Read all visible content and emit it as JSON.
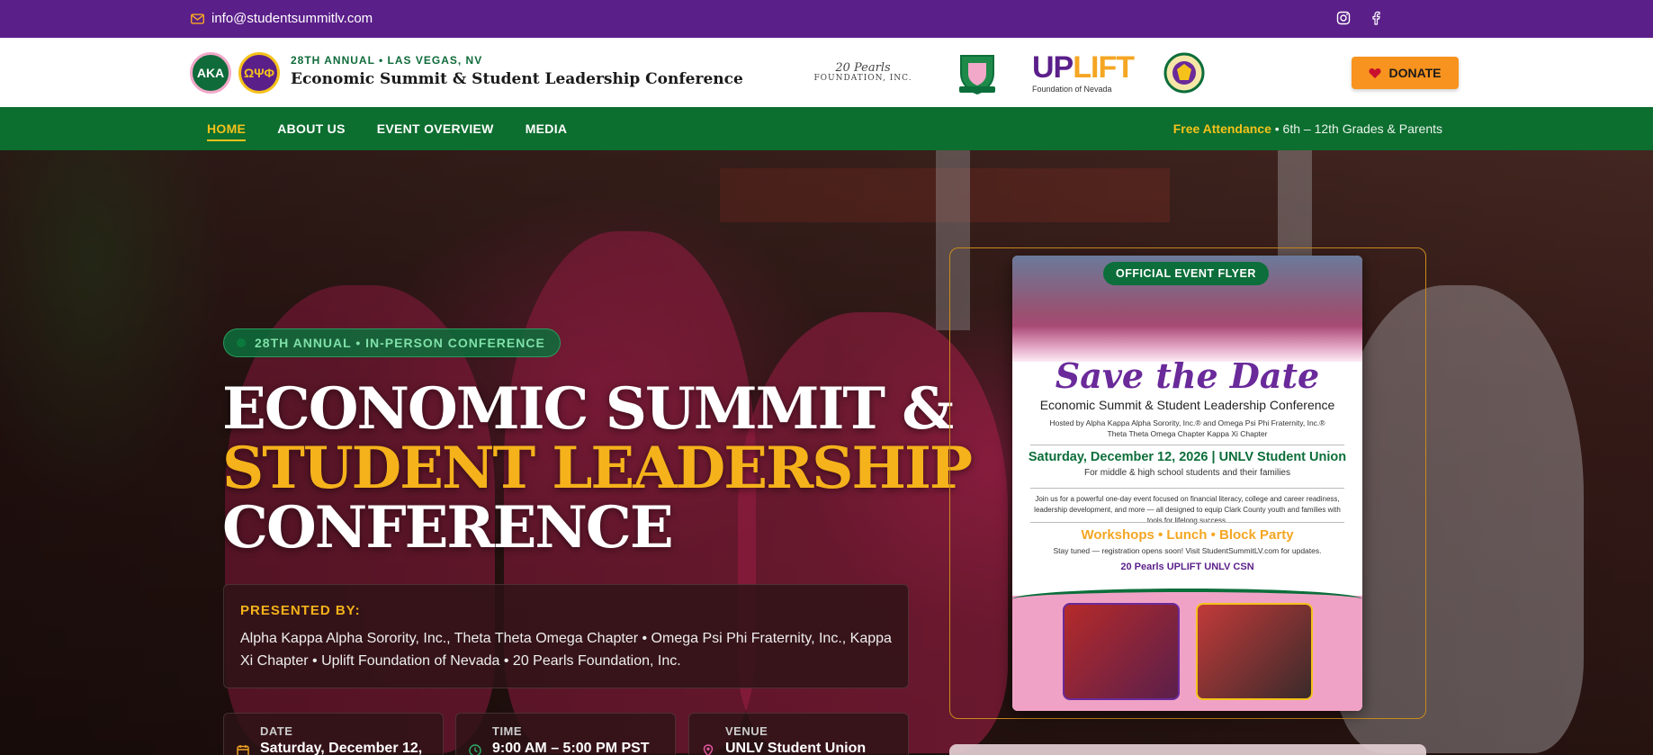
{
  "topbar": {
    "email": "info@studentsummitlv.com",
    "email_icon": "mail-icon",
    "social": [
      "instagram-icon",
      "facebook-icon"
    ]
  },
  "header": {
    "badge_aka": "AKA",
    "badge_opp": "ΩΨΦ",
    "eyebrow": "28TH ANNUAL • LAS VEGAS, NV",
    "title": "Economic Summit & Student Leadership Conference",
    "partners": {
      "pearls_main": "20 Pearls",
      "pearls_sub": "FOUNDATION, INC.",
      "uplift_up": "UP",
      "uplift_lift": "LIFT",
      "uplift_sub": "Foundation of Nevada"
    },
    "donate_label": "DONATE"
  },
  "nav": {
    "items": [
      "HOME",
      "ABOUT US",
      "EVENT OVERVIEW",
      "MEDIA"
    ],
    "note_bold": "Free Attendance",
    "note_rest": " • 6th – 12th Grades & Parents"
  },
  "hero": {
    "pill": "28TH ANNUAL • IN-PERSON CONFERENCE",
    "title_line1": "ECONOMIC SUMMIT &",
    "title_line2": "STUDENT LEADERSHIP",
    "title_line3": "CONFERENCE",
    "presented_label": "PRESENTED BY:",
    "presented_text": "Alpha Kappa Alpha Sorority, Inc., Theta Theta Omega Chapter • Omega Psi Phi Fraternity, Inc., Kappa Xi Chapter • Uplift Foundation of Nevada • 20 Pearls Foundation, Inc.",
    "cards": [
      {
        "label": "DATE",
        "value": "Saturday, December 12,"
      },
      {
        "label": "TIME",
        "value": "9:00 AM – 5:00 PM PST"
      },
      {
        "label": "VENUE",
        "value": "UNLV Student Union"
      }
    ]
  },
  "flyer": {
    "tag": "OFFICIAL EVENT FLYER",
    "save": "Save the Date",
    "subtitle": "Economic Summit & Student Leadership Conference",
    "host1": "Hosted by Alpha Kappa Alpha Sorority, Inc.® and Omega Psi Phi Fraternity, Inc.®",
    "host2": "Theta Theta Omega Chapter                        Kappa Xi Chapter",
    "date": "Saturday, December 12, 2026 | UNLV Student Union",
    "for": "For middle & high school students and their families",
    "body": "Join us for a powerful one-day event focused on financial literacy, college and career readiness, leadership development, and more — all designed to equip Clark County youth and families with tools for lifelong success.",
    "workshops": "Workshops • Lunch • Block Party",
    "stay": "Stay tuned — registration opens soon! Visit StudentSummitLV.com for updates.",
    "logos": "20 Pearls   UPLIFT   UNLV   CSN"
  },
  "colors": {
    "purple": "#5b1f8a",
    "green": "#0c6e2f",
    "gold": "#f5b21b",
    "orange": "#f7931e"
  }
}
